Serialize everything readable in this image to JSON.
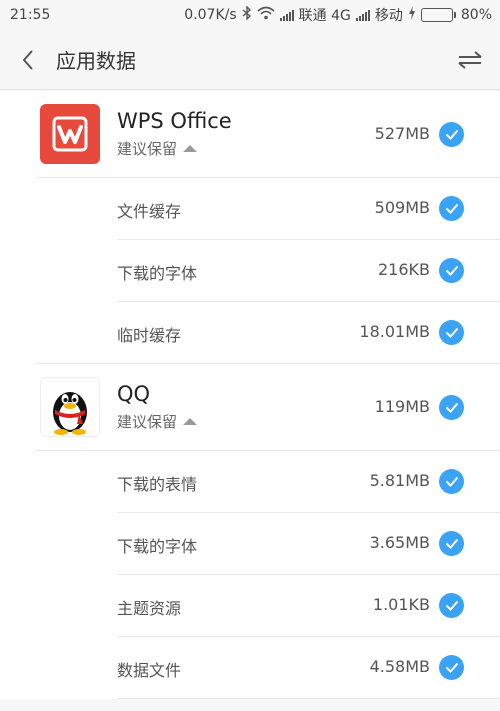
{
  "status_bar": {
    "time": "21:55",
    "speed": "0.07K/s",
    "carrier1": "联通 4G",
    "carrier2": "移动",
    "battery": "80%",
    "battery_level": 0.8
  },
  "header": {
    "title": "应用数据"
  },
  "accent_color": "#3aa3f5",
  "apps": [
    {
      "name": "WPS Office",
      "recommendation": "建议保留",
      "size": "527MB",
      "icon": "wps-office-icon",
      "items": [
        {
          "label": "文件缓存",
          "size": "509MB"
        },
        {
          "label": "下载的字体",
          "size": "216KB"
        },
        {
          "label": "临时缓存",
          "size": "18.01MB"
        }
      ]
    },
    {
      "name": "QQ",
      "recommendation": "建议保留",
      "size": "119MB",
      "icon": "qq-penguin-icon",
      "items": [
        {
          "label": "下载的表情",
          "size": "5.81MB"
        },
        {
          "label": "下载的字体",
          "size": "3.65MB"
        },
        {
          "label": "主题资源",
          "size": "1.01KB"
        },
        {
          "label": "数据文件",
          "size": "4.58MB"
        }
      ]
    }
  ]
}
